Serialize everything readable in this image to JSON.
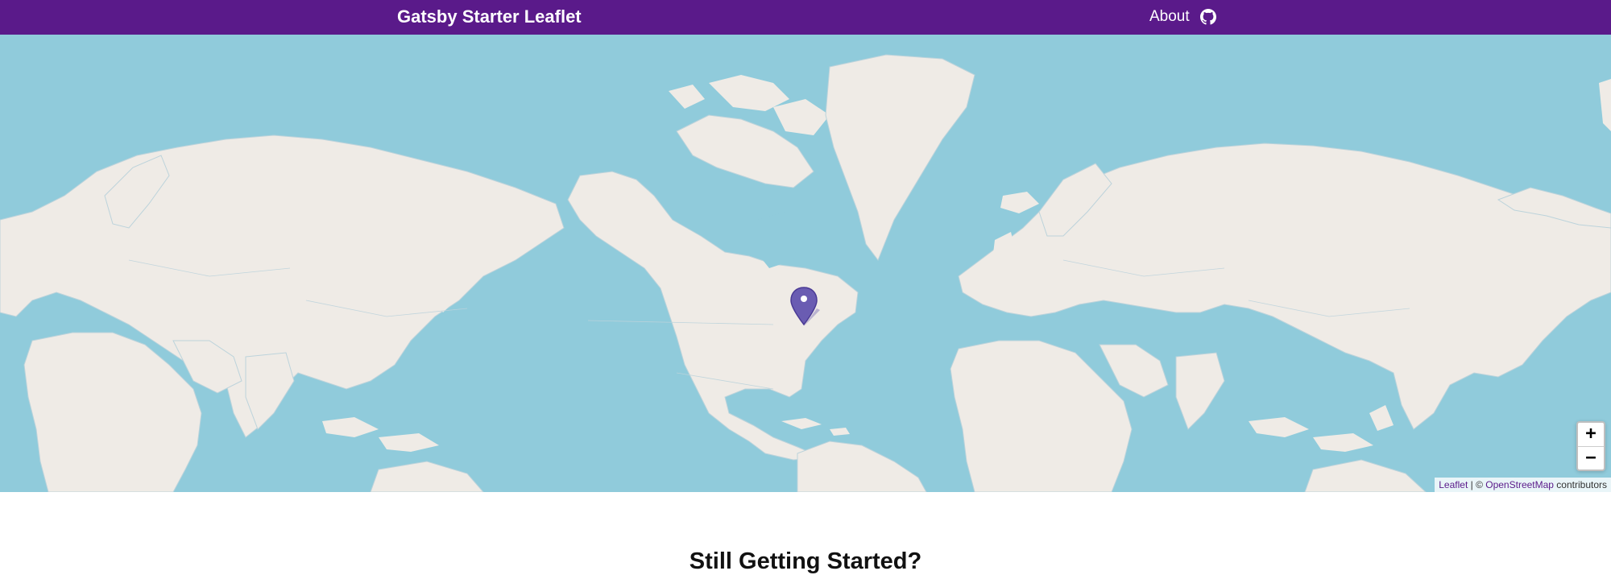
{
  "header": {
    "title": "Gatsby Starter Leaflet",
    "nav_about": "About",
    "github_icon": "github-icon",
    "background_color": "#5a1a8a"
  },
  "map": {
    "tile_source": "OpenStreetMap",
    "water_color": "#90cbdb",
    "land_color": "#efebe6",
    "marker_color": "#5b4aa6",
    "zoom_in_label": "+",
    "zoom_out_label": "−",
    "attribution": {
      "leaflet_label": "Leaflet",
      "separator": " | © ",
      "osm_label": "OpenStreetMap",
      "suffix": " contributors"
    }
  },
  "main": {
    "heading": "Still Getting Started?"
  }
}
